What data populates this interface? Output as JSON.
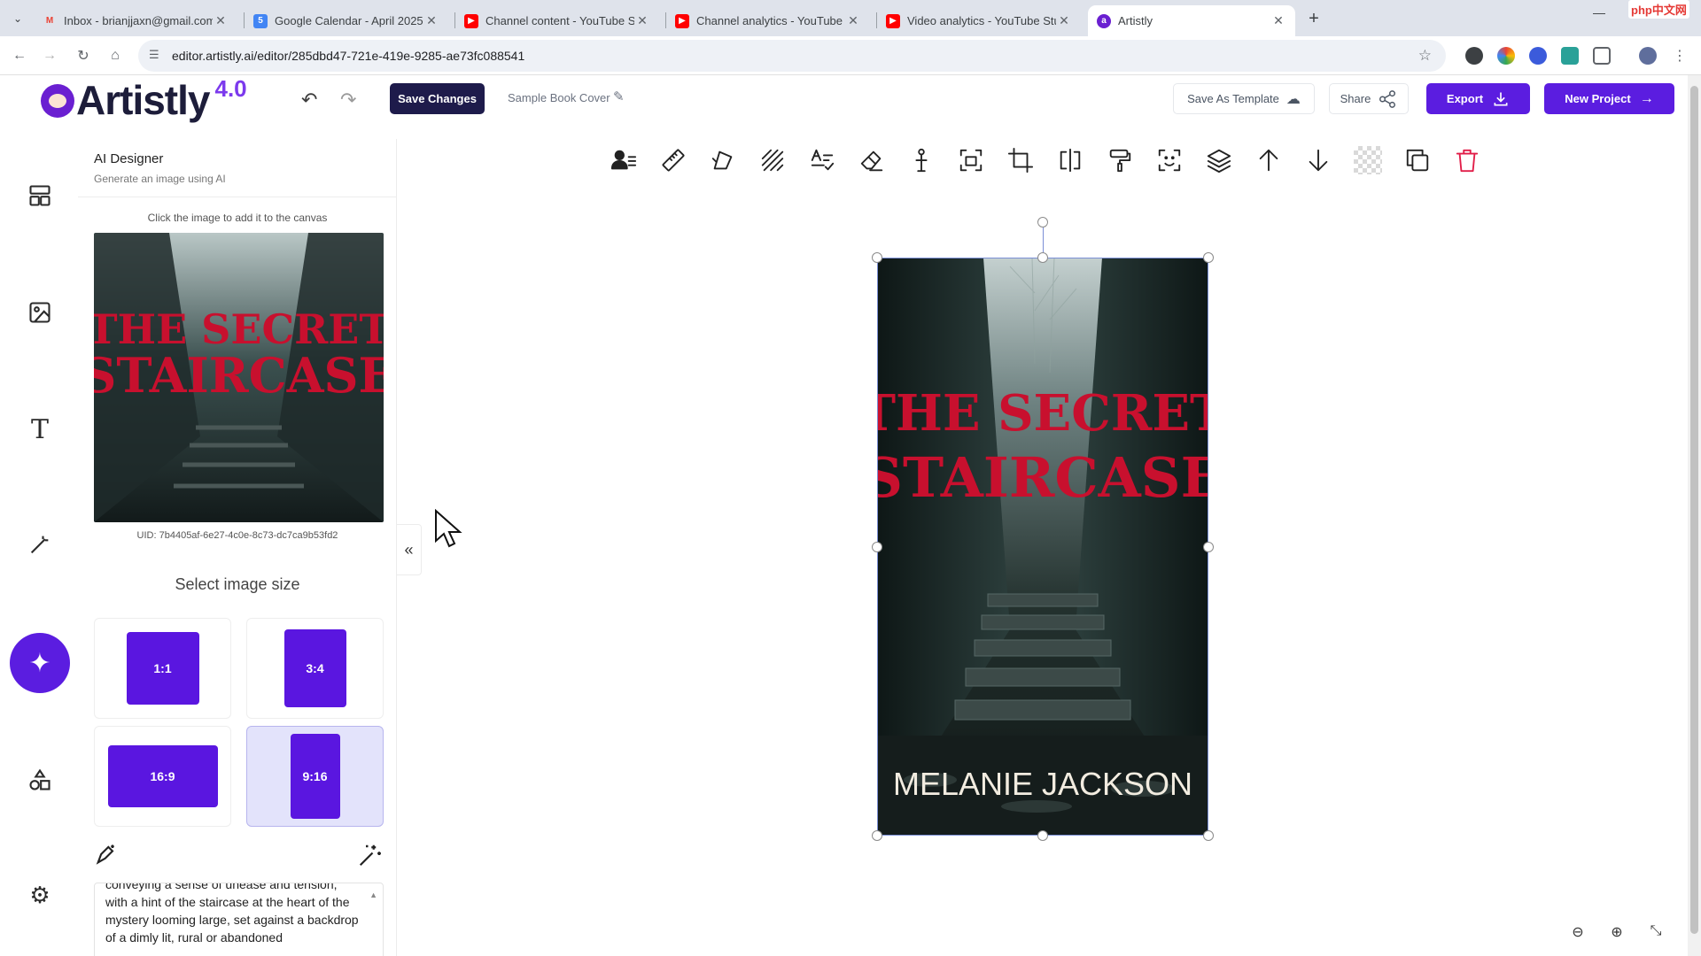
{
  "browser": {
    "tabs": [
      {
        "title": "Inbox - brianjjaxn@gmail.com",
        "favicon": "gmail-icon",
        "color": "#ea4335"
      },
      {
        "title": "Google Calendar - April 2025",
        "favicon": "calendar-icon",
        "color": "#4285f4"
      },
      {
        "title": "Channel content - YouTube Stu",
        "favicon": "youtube-icon",
        "color": "#ff0000"
      },
      {
        "title": "Channel analytics - YouTube St",
        "favicon": "youtube-icon",
        "color": "#ff0000"
      },
      {
        "title": "Video analytics - YouTube Stud",
        "favicon": "youtube-icon",
        "color": "#ff0000"
      },
      {
        "title": "Artistly",
        "favicon": "artistly-icon",
        "color": "#6a1fd1"
      }
    ],
    "url": "editor.artistly.ai/editor/285dbd47-721e-419e-9285-ae73fc088541",
    "watermark": "php中文网"
  },
  "header": {
    "logo_text": "Artistly",
    "logo_version": "4.0",
    "save_label": "Save Changes",
    "project_name": "Sample Book Cover",
    "save_template_label": "Save As Template",
    "share_label": "Share",
    "export_label": "Export",
    "new_project_label": "New Project"
  },
  "rail": {
    "items": [
      "templates-icon",
      "image-icon",
      "text-icon",
      "magic-wand-icon",
      "ai-sparkle-icon",
      "shapes-icon",
      "settings-icon"
    ],
    "active": "ai-sparkle-icon"
  },
  "panel": {
    "title": "AI Designer",
    "subtitle": "Generate an image using AI",
    "hint": "Click the image to add it to the canvas",
    "uid": "UID: 7b4405af-6e27-4c0e-8c73-dc7ca9b53fd2",
    "size_title": "Select image size",
    "sizes": [
      "1:1",
      "3:4",
      "16:9",
      "9:16"
    ],
    "selected_size": "9:16",
    "prompt": "conveying a sense of unease and tension, with a hint of the staircase at the heart of the mystery looming large, set against a backdrop of a dimly lit, rural or abandoned"
  },
  "cover": {
    "title_line1": "THE SECRET",
    "title_line2": "STAIRCASE",
    "author": "MELANIE JACKSON",
    "title_color": "#c8102e"
  },
  "toolbar_icons": [
    "user-list-icon",
    "ruler-icon",
    "skew-icon",
    "pattern-icon",
    "text-check-icon",
    "eraser-icon",
    "anchor-icon",
    "focus-icon",
    "crop-icon",
    "flip-icon",
    "paint-roller-icon",
    "scan-face-icon",
    "layers-icon",
    "arrow-up-icon",
    "arrow-down-icon",
    "transparency-icon",
    "duplicate-icon",
    "delete-icon"
  ],
  "accent": "#5b1de0"
}
